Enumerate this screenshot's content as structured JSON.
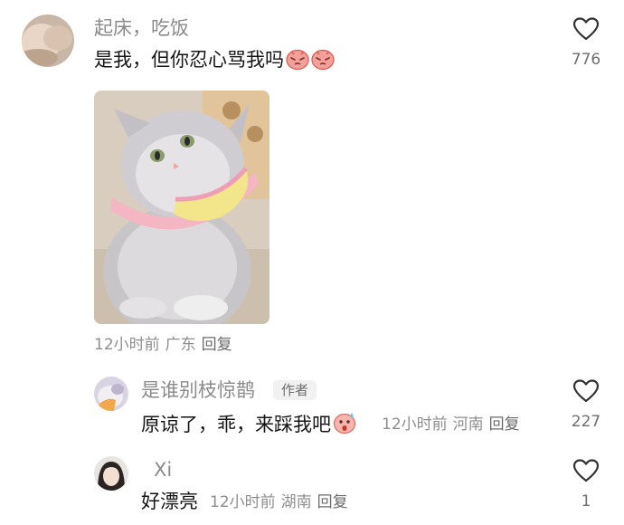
{
  "comment": {
    "username": "起床，吃饭",
    "text": "是我，但你忍心骂我吗",
    "emoji_names": [
      "pouting-face-emoji",
      "pouting-face-emoji"
    ],
    "meta": {
      "time": "12小时前",
      "location": "广东",
      "reply": "回复"
    },
    "likes": "776"
  },
  "replies": [
    {
      "username": "是谁别枝惊鹊",
      "badge": "作者",
      "text": "原谅了，乖，来踩我吧",
      "emoji_name": "sweating-face-emoji",
      "meta": {
        "time": "12小时前",
        "location": "河南",
        "reply": "回复"
      },
      "likes": "227"
    },
    {
      "username": "Xi",
      "text": "好漂亮",
      "meta": {
        "time": "12小时前",
        "location": "湖南",
        "reply": "回复"
      },
      "likes": "1"
    }
  ],
  "icons": {
    "like": "heart-outline-icon"
  },
  "colors": {
    "text": "#161616",
    "secondary": "#8a8a8a",
    "badge_bg": "#f1f1f1"
  }
}
